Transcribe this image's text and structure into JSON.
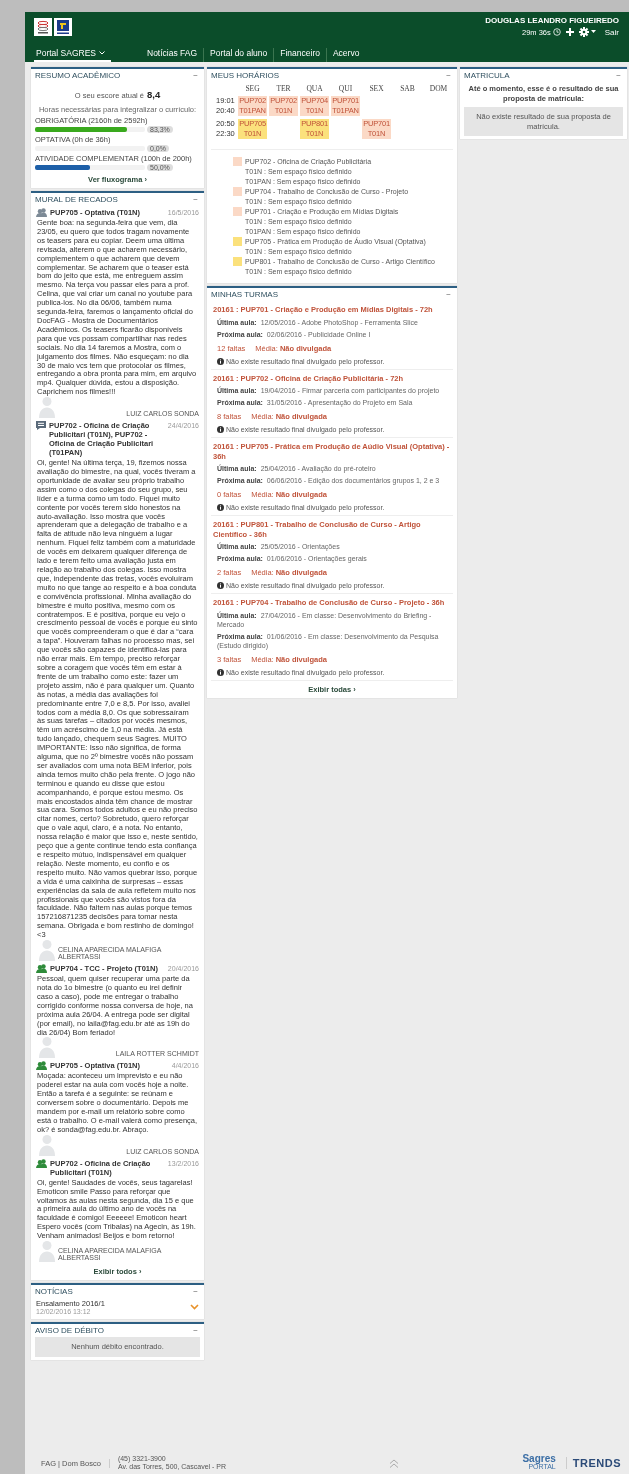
{
  "header": {
    "user": "DOUGLAS LEANDRO FIGUEIREDO",
    "session_time": "29m 36s",
    "logout": "Sair"
  },
  "nav": [
    {
      "label": "Portal SAGRES",
      "selected": true,
      "dropdown": true
    },
    {
      "label": "Notícias FAG",
      "selected": false,
      "dropdown": false
    },
    {
      "label": "Portal do aluno",
      "selected": false,
      "dropdown": false
    },
    {
      "label": "Financeiro",
      "selected": false,
      "dropdown": false
    },
    {
      "label": "Acervo",
      "selected": false,
      "dropdown": false
    }
  ],
  "resumo": {
    "title": "RESUMO ACADÊMICO",
    "collapse": "−",
    "score_label": "O seu escore atual é",
    "score": "8,4",
    "hours_label": "Horas necessárias para integralizar o currículo:",
    "bars": [
      {
        "label": "OBRIGATÓRIA (2160h de 2592h)",
        "level": 0.833,
        "reading": "83,3%",
        "color": "#3aa91e"
      },
      {
        "label": "OPTATIVA (0h de 36h)",
        "reading": "0,0%"
      },
      {
        "label": "ATIVIDADE COMPLEMENTAR (100h de 200h)",
        "level": 0.5,
        "reading": "50,0%",
        "color": "#1d5fa8"
      }
    ],
    "link": "Ver fluxograma ›"
  },
  "mural": {
    "title": "MURAL DE RECADOS",
    "collapse": "−",
    "messages": [
      {
        "kind": "group",
        "color": "#7d8a96",
        "title": "PUP705 - Optativa (T01N)",
        "date": "16/5/2016",
        "text": "Gente boa: na segunda-feira que vem, dia 23/05, eu quero que todos tragam novamente os teasers para eu copiar. Deem uma última revisada, alterem o que acharem necessário, complementem o que acharem que devem complementar. Se acharem que o teaser está bom do jeito que está, me entreguem assim mesmo. Na terça vou passar eles para a prof. Celina, que vai criar um canal no youtube para publica-los. No dia 06/06, também numa segunda-feira, faremos o lançamento oficial do DocFAG - Mostra de Documentários Acadêmicos. Os teasers ficarão disponíveis para que vcs possam compartilhar nas redes sociais. No dia 14 faremos a Mostra, com o julgamento dos filmes. Não esqueçam: no dia 30 de maio vcs tem que protocolar os filmes, entregando a obra pronta para mim, em arquivo mp4. Qualquer dúvida, estou a disposição. Caprichem nos filmes!!!",
        "author": "LUIZ CARLOS SONDA"
      },
      {
        "kind": "note",
        "color": "#5a6a7a",
        "title": "PUP702 - Oficina de Criação Publicitari (T01N), PUP702 - Oficina de Criação Publicitari (T01PAN)",
        "date": "24/4/2016",
        "text": "Oi, gente! Na última terça, 19, fizemos nossa avaliação do bimestre, na qual, vocês tiveram a oportunidade de avaliar seu próprio trabalho assim como o dos colegas do seu grupo, seu líder e a turma como um todo. Fiquei muito contente por vocês terem sido honestos na auto-avaliação. Isso mostra que vocês aprenderam que a delegação de trabalho e a falta de atitude não leva ninguém a lugar nenhum. Fiquei feliz também com a maturidade de vocês em deixarem qualquer diferença de lado e terem feito uma avaliação justa em relação ao trabalho dos colegas. Isso mostra que, independente das tretas, vocês evoluíram muito no que tange ao respeito e à boa conduta e convivência profissional. Minha avaliação do bimestre é muito positiva, mesmo com os contratempos. E é positiva, porque eu vejo o crescimento pessoal de vocês e porque eu sinto que vocês compreenderam o que é dar a “cara a tapa”. Houveram falhas no processo mas, sei que vocês são capazes de identificá-las para não errar mais. Em tempo, preciso reforçar sobre a coragem que vocês têm em estar à frente de um trabalho como este: fazer um projeto assim, não é para qualquer um. Quanto às notas, a média das avaliações foi predominante entre 7,0 e 8,5. Por isso, avaliei todos com a média 8,0. Os que sobressaíram às suas tarefas – citados por vocês mesmos, têm um acréscimo de 1,0 na média. Já está tudo lançado, chequem seus Sagres. MUITO IMPORTANTE: Isso não significa, de forma alguma, que no 2º bimestre vocês não possam ser avaliados com uma nota BEM inferior, pois ainda temos muito chão pela frente. O jogo não terminou e quando eu disse que estou acompanhando, é porque estou mesmo. Os mais encostados ainda têm chance de mostrar sua cara. Somos todos adultos e eu não preciso citar nomes, certo? Sobretudo, quero reforçar que o vale aqui, claro, é a nota. No entanto, nossa relação é maior que isso e, neste sentido, peço que a gente continue tendo esta confiança e respeito mútuo, indispensável em qualquer relação. Neste momento, eu confio e os respeito muito. Não vamos quebrar isso, porque a vida é uma caixinha de surpresas – essas experiências da sala de aula refletem muito nos profissionais que vocês são vistos fora da faculdade. Não faltem nas aulas porque temos 157216871235 decisões para tomar nesta semana. Obrigada e bom restinho de domingo! <3",
        "author": "CELINA APARECIDA MALAFIGA ALBERTASSI"
      },
      {
        "kind": "group",
        "color": "#2e8b3a",
        "title": "PUP704 - TCC - Projeto (T01N)",
        "date": "20/4/2016",
        "text": "Pessoal, quem quiser recuperar uma parte da nota do 1o bimestre (o quanto eu irei definir caso a caso), pode me entregar o trabalho corrigido conforme nossa conversa de hoje, na próxima aula 26/04. A entrega pode ser digital (por email), no laila@fag.edu.br até as 19h do dia 26/04) Bom feriado!",
        "author": "LAILA ROTTER SCHMIDT"
      },
      {
        "kind": "group",
        "color": "#2e8b3a",
        "title": "PUP705 - Optativa (T01N)",
        "date": "4/4/2016",
        "text": "Moçada: aconteceu um imprevisto e eu não poderei estar na aula com vocês hoje a noite. Então a tarefa é a seguinte: se reúnam e conversem sobre o documentário. Depois me mandem por e-mail um relatório sobre como está o trabalho. O e-mail valerá como presença, ok? é sonda@fag.edu.br. Abraço.",
        "author": "LUIZ CARLOS SONDA"
      },
      {
        "kind": "group",
        "color": "#2e8b3a",
        "title": "PUP702 - Oficina de Criação Publicitari (T01N)",
        "date": "13/2/2016",
        "text": "Oi, gente! Saudades de vocês, seus tagarelas! Emoticon smile Passo para reforçar que voltamos às aulas nesta segunda, dia 15 e que a primeira aula do último ano de vocês na faculdade é comigo! Eeeeee! Emoticon heart Espero vocês (com Tribalas) na Agecin, às 19h. Venham animados! Beijos e bom retorno!",
        "author": "CELINA APARECIDA MALAFIGA ALBERTASSI"
      }
    ],
    "link": "Exibir todos ›"
  },
  "noticias": {
    "title": "NOTÍCIAS",
    "collapse": "−",
    "items": [
      {
        "title": "Ensalamento 2016/1",
        "date": "12/02/2016 13:12",
        "expanded": false
      }
    ]
  },
  "aviso": {
    "title": "AVISO DE DÉBITO",
    "collapse": "−",
    "message": "Nenhum débito encontrado."
  },
  "horarios": {
    "title": "MEUS HORÁRIOS",
    "collapse": "−",
    "days": [
      "SEG",
      "TER",
      "QUA",
      "QUI",
      "SEX",
      "SAB",
      "DOM"
    ],
    "rows": [
      {
        "start": "19:01",
        "end": "20:40",
        "cells": [
          {
            "code": "PUP702",
            "class": "T01PAN",
            "color": "#fbd9c6"
          },
          {
            "code": "PUP702",
            "class": "T01N",
            "color": "#fbd9c6"
          },
          {
            "code": "PUP704",
            "class": "T01N",
            "color": "#fbd9c6"
          },
          {
            "code": "PUP701",
            "class": "T01PAN",
            "color": "#fbd9c6"
          },
          null,
          null,
          null
        ]
      },
      {
        "start": "20:50",
        "end": "22:30",
        "cells": [
          {
            "code": "PUP705",
            "class": "T01N",
            "color": "#fbe17c"
          },
          null,
          {
            "code": "PUP801",
            "class": "T01N",
            "color": "#fbe17c"
          },
          null,
          {
            "code": "PUP701",
            "class": "T01N",
            "color": "#fbd9c6"
          },
          null,
          null
        ]
      }
    ],
    "legend": [
      {
        "color": "#fbd9c6",
        "title": "PUP702 - Oficina de Criação Publicitária",
        "rooms": [
          "T01N : Sem espaço físico definido",
          "T01PAN : Sem espaço físico definido"
        ]
      },
      {
        "color": "#fbd9c6",
        "title": "PUP704 - Trabalho de Conclusão de Curso - Projeto",
        "rooms": [
          "T01N : Sem espaço físico definido"
        ]
      },
      {
        "color": "#fbd9c6",
        "title": "PUP701 - Criação e Produção em Mídias Digitais",
        "rooms": [
          "T01N : Sem espaço físico definido",
          "T01PAN : Sem espaço físico definido"
        ]
      },
      {
        "color": "#fbe17c",
        "title": "PUP705 - Prática em Produção de Áudio Visual (Optativa)",
        "rooms": [
          "T01N : Sem espaço físico definido"
        ]
      },
      {
        "color": "#fbe17c",
        "title": "PUP801 - Trabalho de Conclusão de Curso - Artigo Científico",
        "rooms": [
          "T01N : Sem espaço físico definido"
        ]
      }
    ]
  },
  "turmas": {
    "title": "MINHAS TURMAS",
    "collapse": "−",
    "items": [
      {
        "title": "20161 : PUP701 - Criação e Produção em Mídias Digitais - 72h",
        "last_label": "Última aula:",
        "last": "12/05/2016 - Adobe PhotoShop - Ferramenta Slice",
        "next_label": "Próxima aula:",
        "next": "02/06/2016 - Publicidade Online I",
        "absences": "12 faltas",
        "media_label": "Média:",
        "media": "Não divulgada",
        "note": "Não existe resultado final divulgado pelo professor."
      },
      {
        "title": "20161 : PUP702 - Oficina de Criação Publicitária - 72h",
        "last_label": "Última aula:",
        "last": "19/04/2016 - Firmar parceria com participantes do projeto",
        "next_label": "Próxima aula:",
        "next": "31/05/2016 - Apresentação do Projeto em Sala",
        "absences": "8 faltas",
        "media_label": "Média:",
        "media": "Não divulgada",
        "note": "Não existe resultado final divulgado pelo professor."
      },
      {
        "title": "20161 : PUP705 - Prática em Produção de Aúdio Visual (Optativa) - 36h",
        "last_label": "Última aula:",
        "last": "25/04/2016 - Avaliação do pré-roteiro",
        "next_label": "Próxima aula:",
        "next": "06/06/2016 - Edição dos documentários grupos 1, 2 e 3",
        "absences": "0 faltas",
        "media_label": "Média:",
        "media": "Não divulgada",
        "note": "Não existe resultado final divulgado pelo professor."
      },
      {
        "title": "20161 : PUP801 - Trabalho de Conclusão de Curso - Artigo Científico - 36h",
        "last_label": "Última aula:",
        "last": "25/05/2016 - Orientações",
        "next_label": "Próxima aula:",
        "next": "01/06/2016 - Orientações gerais",
        "absences": "2 faltas",
        "media_label": "Média:",
        "media": "Não divulgada",
        "note": "Não existe resultado final divulgado pelo professor."
      },
      {
        "title": "20161 : PUP704 - Trabalho de Conclusão de Curso - Projeto - 36h",
        "last_label": "Última aula:",
        "last": "27/04/2016 - Em classe: Desenvolvimento do Briefing - Mercado",
        "next_label": "Próxima aula:",
        "next": "01/06/2016 - Em classe: Desenvolvimento da Pesquisa (Estudo dirigido)",
        "absences": "3 faltas",
        "media_label": "Média:",
        "media": "Não divulgada",
        "note": "Não existe resultado final divulgado pelo professor."
      }
    ],
    "link": "Exibir todas ›"
  },
  "matricula": {
    "title": "MATRICULA",
    "collapse": "−",
    "intro": "Até o momento, esse é o resultado de sua proposta de matrícula:",
    "message": "Não existe resultado de sua proposta de matrícula."
  },
  "footer": {
    "institution": "FAG | Dom Bosco",
    "phone": "(45) 3321-3900",
    "address": "Av. das Torres, 500, Cascavel - PR",
    "sagres": "Sagres",
    "sagres_sub": "PORTAL",
    "trends": "TRENDS"
  }
}
